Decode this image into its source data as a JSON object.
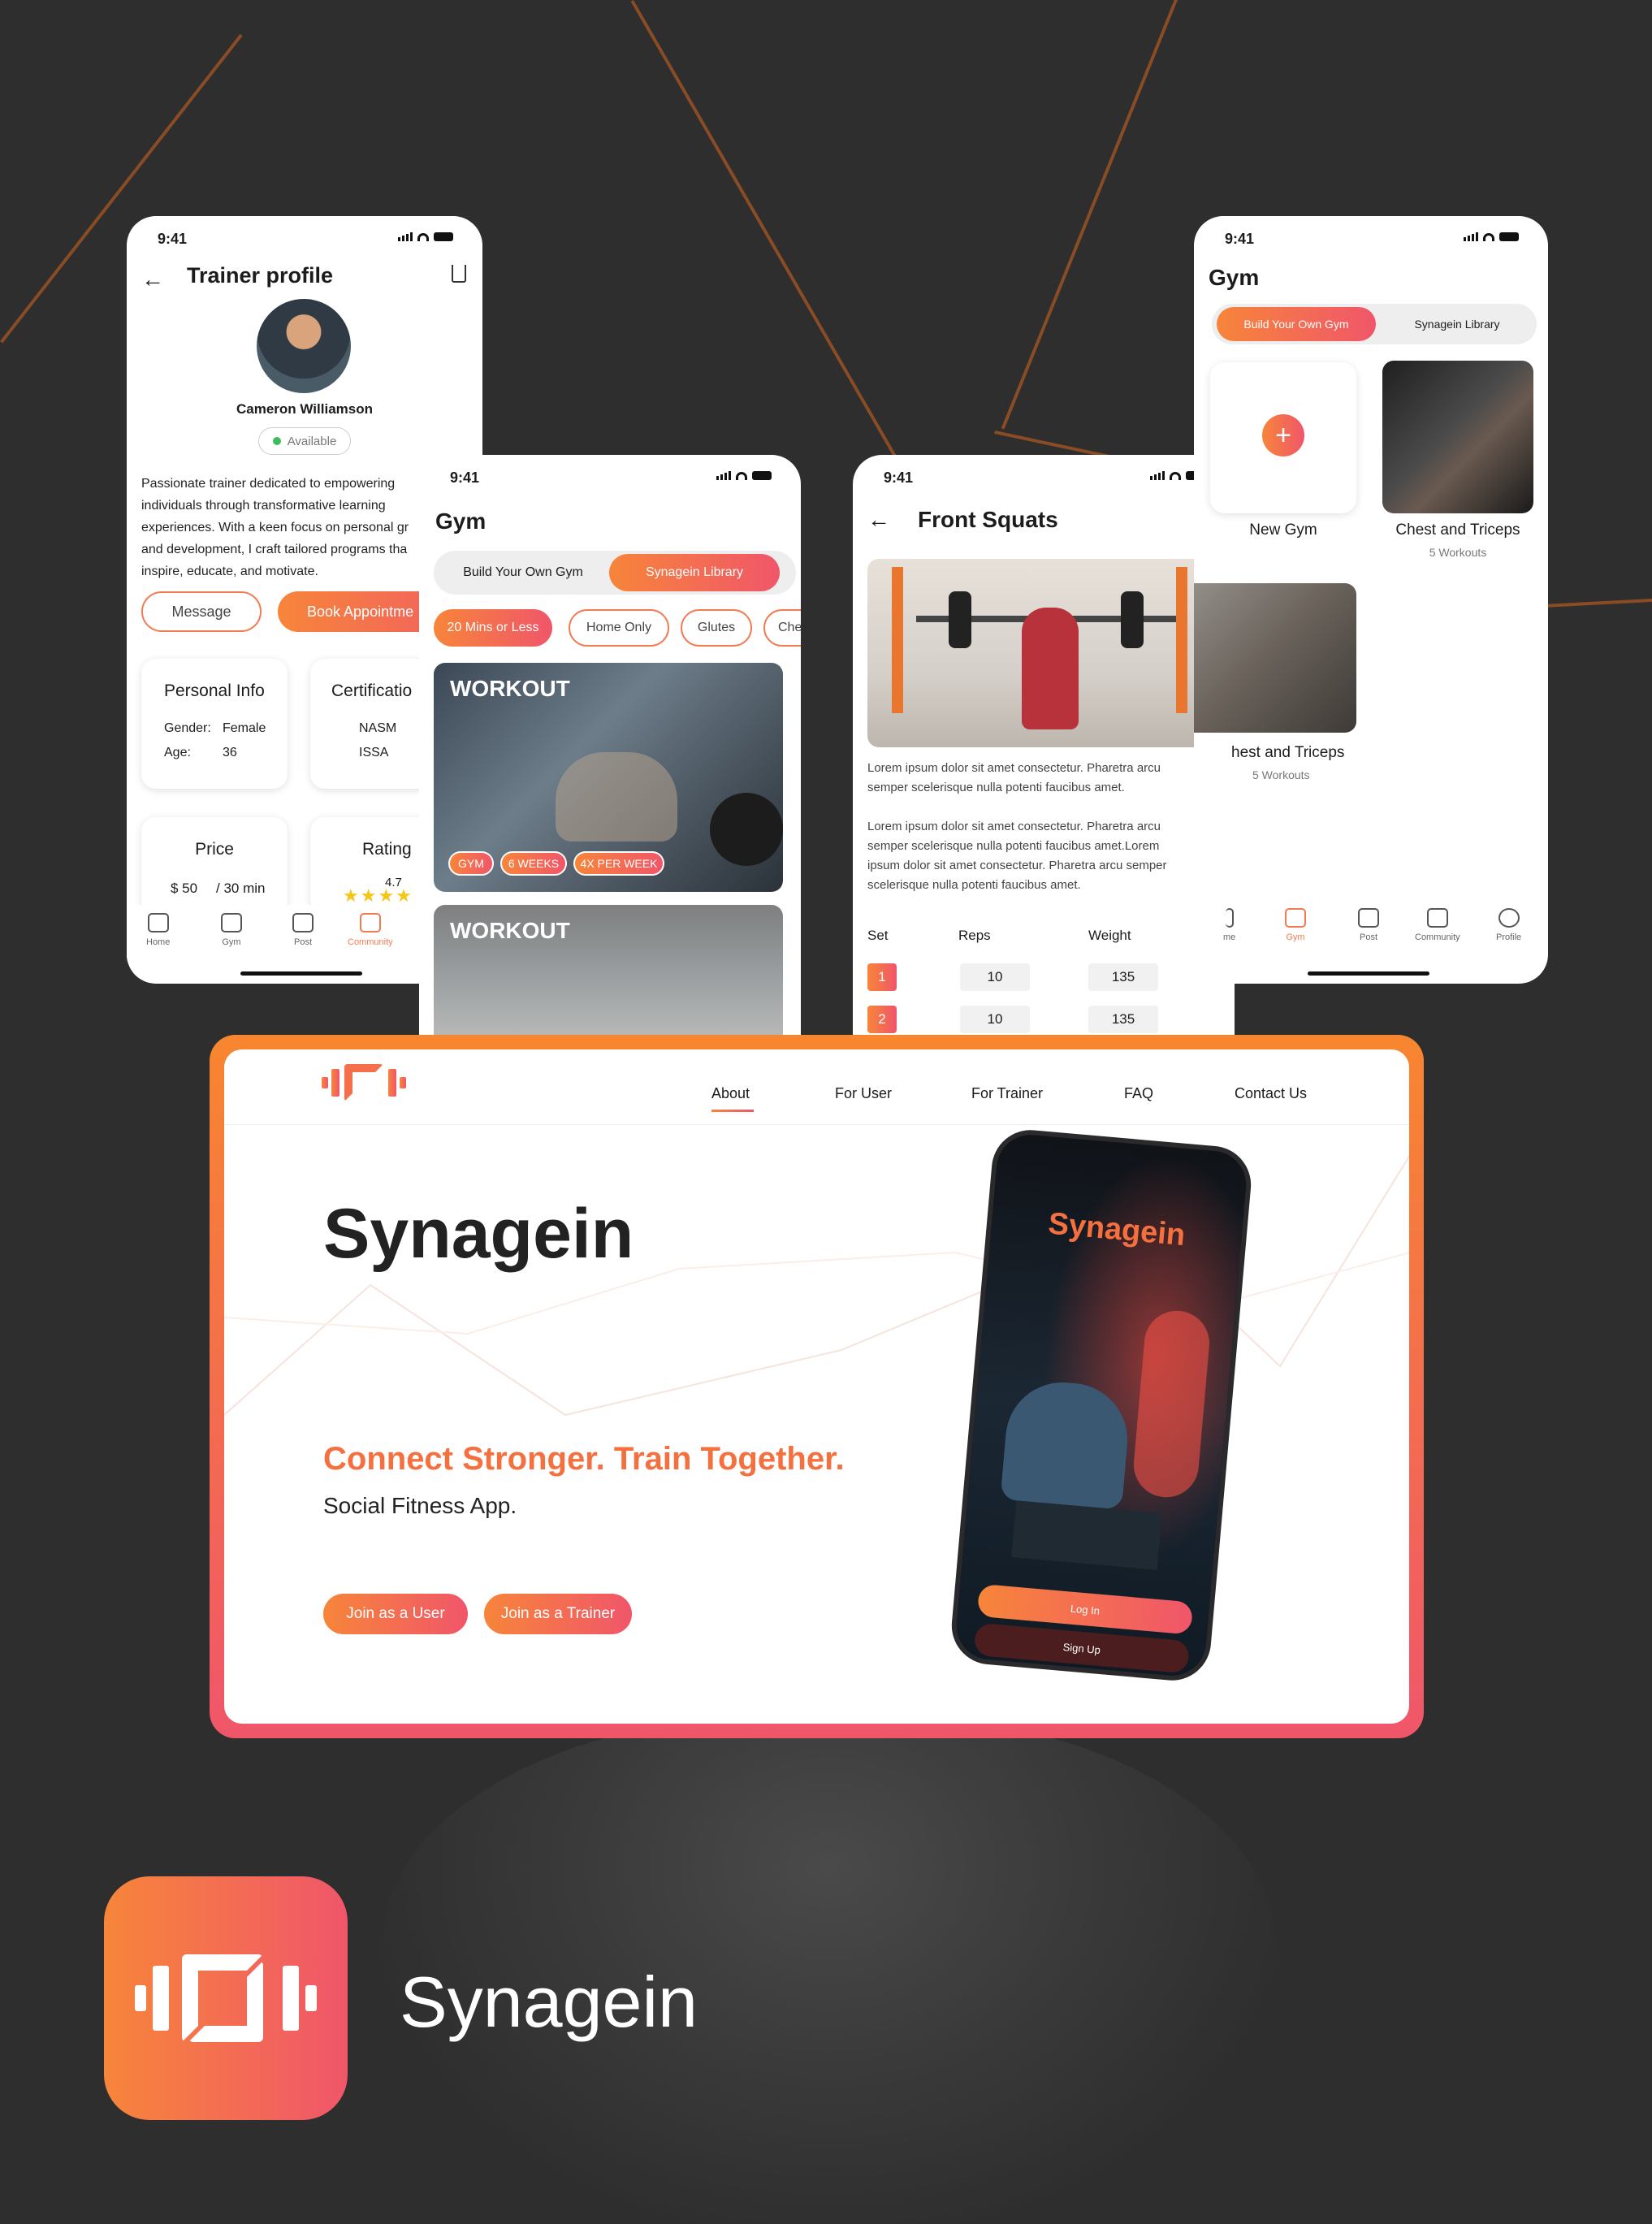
{
  "colors": {
    "background": "#2e2e2e",
    "accent_orange": "#f7853a",
    "accent_pink": "#f0566a",
    "decor_line": "#8a4c25",
    "available_green": "#3dbb5e"
  },
  "status_time": "9:41",
  "trainer": {
    "title": "Trainer profile",
    "name": "Cameron Williamson",
    "availability": "Available",
    "bio": "Passionate trainer dedicated to empowering individuals through transformative learning experiences. With a keen focus on personal gr and development, I craft tailored programs tha inspire, educate, and motivate.",
    "bio_lines": [
      "Passionate trainer dedicated to empowering",
      "individuals through transformative learning",
      "experiences. With a keen focus on personal gr",
      "and development, I craft tailored programs tha",
      "inspire, educate, and motivate."
    ],
    "message_label": "Message",
    "book_label": "Book Appointme",
    "personal_info": {
      "title": "Personal Info",
      "gender_label": "Gender:",
      "gender": "Female",
      "age_label": "Age:",
      "age": "36"
    },
    "certification": {
      "title": "Certificatio",
      "items": [
        "NASM",
        "ISSA"
      ]
    },
    "price": {
      "title": "Price",
      "amount": "$ 50",
      "unit": "/ 30 min"
    },
    "rating": {
      "title": "Rating",
      "value": "4.7",
      "stars": 4.7
    },
    "nav": [
      "Home",
      "Gym",
      "Post",
      "Community"
    ]
  },
  "gym_library": {
    "title": "Gym",
    "tabs": [
      "Build Your Own Gym",
      "Synagein Library"
    ],
    "filters": [
      "20 Mins or Less",
      "Home Only",
      "Glutes",
      "Che"
    ],
    "workouts": [
      {
        "label": "WORKOUT",
        "tags": [
          "GYM",
          "6 WEEKS",
          "4X PER WEEK"
        ]
      },
      {
        "label": "WORKOUT",
        "tags": []
      }
    ]
  },
  "front_squats": {
    "title": "Front Squats",
    "para1_lines": [
      "Lorem ipsum dolor sit amet consectetur. Pharetra arcu",
      "semper scelerisque nulla potenti faucibus amet."
    ],
    "para2_lines": [
      "Lorem ipsum dolor sit amet consectetur. Pharetra arcu",
      "semper scelerisque nulla potenti faucibus amet.Lorem",
      "ipsum dolor sit amet consectetur. Pharetra arcu semper",
      "scelerisque nulla potenti faucibus amet."
    ],
    "columns": [
      "Set",
      "Reps",
      "Weight"
    ],
    "rows": [
      {
        "set": "1",
        "reps": "10",
        "weight": "135"
      },
      {
        "set": "2",
        "reps": "10",
        "weight": "135"
      }
    ]
  },
  "gym_own": {
    "title": "Gym",
    "tabs": [
      "Build Your Own Gym",
      "Synagein Library"
    ],
    "new_gym_label": "New Gym",
    "cards": [
      {
        "title": "Chest and Triceps",
        "sub": "5 Workouts"
      },
      {
        "title": "hest and Triceps",
        "sub": "5 Workouts"
      }
    ],
    "nav": [
      "me",
      "Gym",
      "Post",
      "Community",
      "Profile"
    ]
  },
  "website": {
    "nav": [
      "About",
      "For User",
      "For Trainer",
      "FAQ",
      "Contact Us"
    ],
    "hero_title": "Synagein",
    "tagline": "Connect Stronger. Train Together.",
    "subtitle": "Social Fitness App.",
    "cta_user": "Join as a User",
    "cta_trainer": "Join as a Trainer",
    "phone_title": "Synagein",
    "phone_login": "Log In",
    "phone_signup": "Sign Up"
  },
  "brand": {
    "name": "Synagein"
  }
}
